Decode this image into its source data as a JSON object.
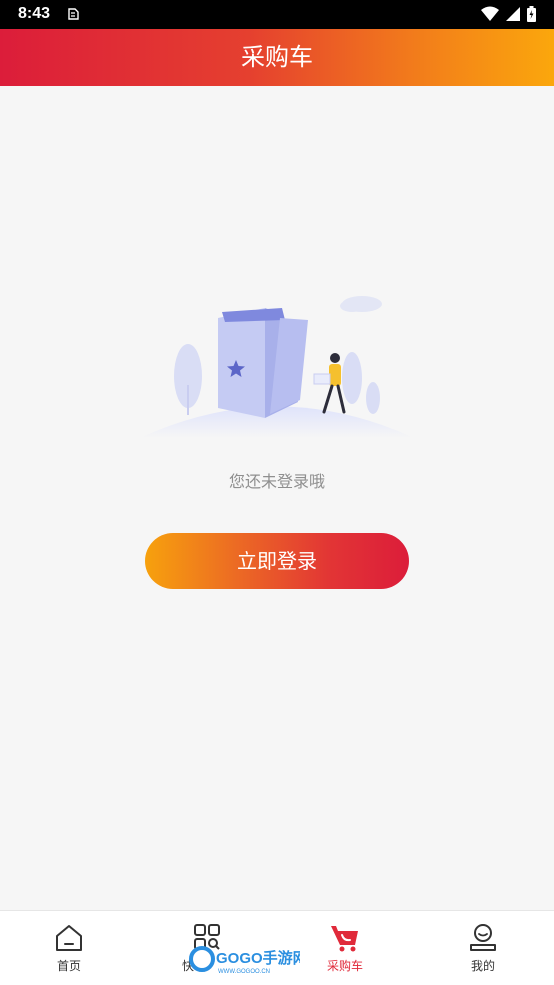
{
  "status_bar": {
    "time": "8:43"
  },
  "header": {
    "title": "采购车"
  },
  "empty_state": {
    "message": "您还未登录哦"
  },
  "login_button": {
    "label": "立即登录"
  },
  "tabbar": {
    "items": [
      {
        "label": "首页",
        "icon": "home-icon",
        "active": false
      },
      {
        "label": "快",
        "icon": "qr-scan-icon",
        "active": false
      },
      {
        "label": "采购车",
        "icon": "cart-icon",
        "active": true
      },
      {
        "label": "我的",
        "icon": "profile-icon",
        "active": false
      }
    ]
  },
  "watermark": {
    "text": "GOGO手游网",
    "sub": "WWW.GOGOO.CN"
  },
  "colors": {
    "brand_red": "#dc1d3a",
    "brand_orange": "#fba70c",
    "active_tab": "#e02a3a"
  }
}
